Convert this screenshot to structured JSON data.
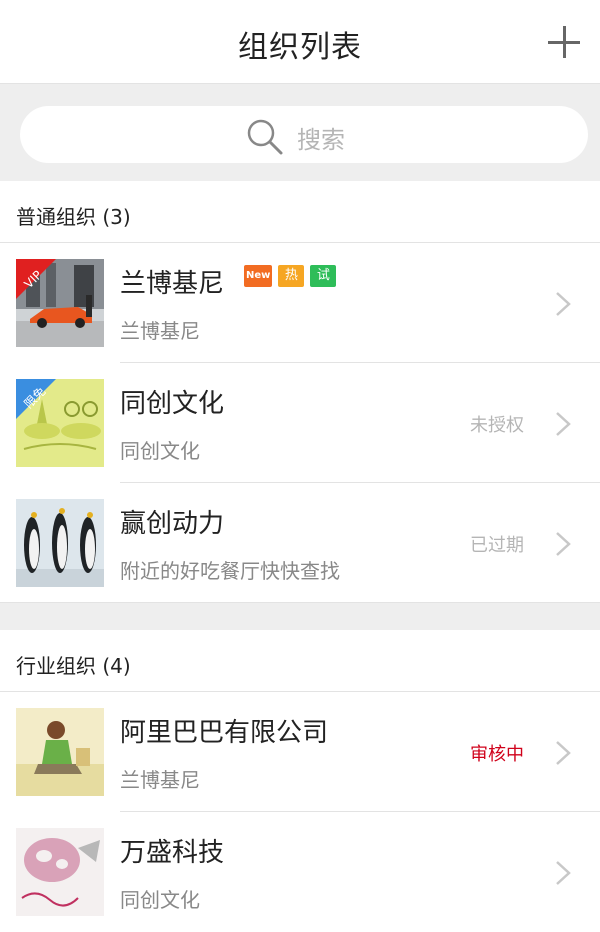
{
  "header": {
    "title": "组织列表"
  },
  "search": {
    "placeholder": "搜索"
  },
  "colors": {
    "status_pending": "#d0021b",
    "status_muted": "#b5b5b5",
    "badge_new": "#f26c22",
    "badge_hot": "#f6a623",
    "badge_trial": "#2ebd59"
  },
  "sections": [
    {
      "title": "普通组织",
      "count": "(3)",
      "items": [
        {
          "name": "兰博基尼",
          "desc": "兰博基尼",
          "status": "",
          "badges": [
            "New",
            "热",
            "试"
          ],
          "ribbon": "VIP",
          "avatar_icon": "car-icon"
        },
        {
          "name": "同创文化",
          "desc": "同创文化",
          "status": "未授权",
          "badges": [],
          "ribbon": "限免",
          "avatar_icon": "frog-icon"
        },
        {
          "name": "赢创动力",
          "desc": "附近的好吃餐厅快快查找",
          "status": "已过期",
          "badges": [],
          "ribbon": "",
          "avatar_icon": "penguin-icon"
        }
      ]
    },
    {
      "title": "行业组织",
      "count": "(4)",
      "items": [
        {
          "name": "阿里巴巴有限公司",
          "desc": "兰博基尼",
          "status": "审核中",
          "badges": [],
          "ribbon": "",
          "avatar_icon": "person-icon"
        },
        {
          "name": "万盛科技",
          "desc": "同创文化",
          "status": "",
          "badges": [],
          "ribbon": "",
          "avatar_icon": "cartoon-icon"
        }
      ]
    }
  ]
}
